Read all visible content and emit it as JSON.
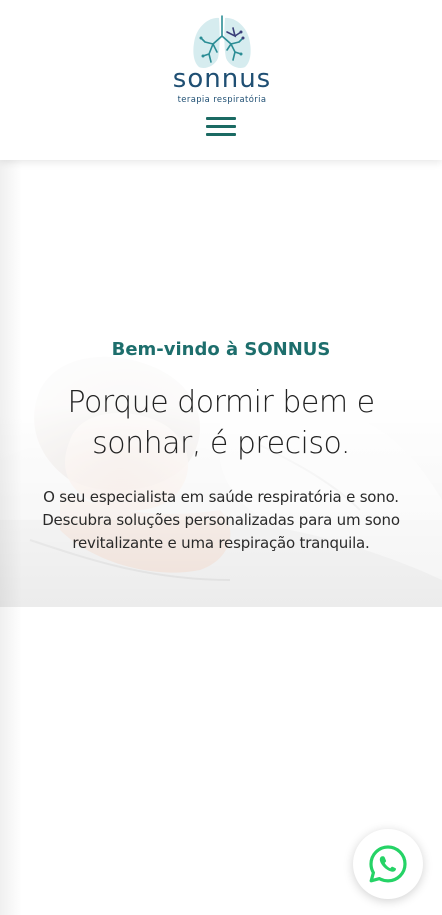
{
  "header": {
    "brand_name": "sonnus",
    "brand_tagline": "terapia respiratória",
    "menu_icon": "hamburger-menu-icon",
    "colors": {
      "brand": "#1f4f73",
      "accent": "#1b6a63"
    }
  },
  "hero": {
    "welcome": "Bem-vindo à SONNUS",
    "headline": "Porque dormir bem e sonhar, é preciso.",
    "description": "O seu especialista em saúde respiratória e sono. Descubra soluções personalizadas para um sono revitalizante e uma respiração tranquila.",
    "image": "woman-sleeping-image",
    "colors": {
      "welcome": "#1d6e6c",
      "headline": "#222222"
    }
  },
  "floating": {
    "whatsapp_icon": "whatsapp-icon",
    "colors": {
      "whatsapp": "#25d366"
    }
  }
}
